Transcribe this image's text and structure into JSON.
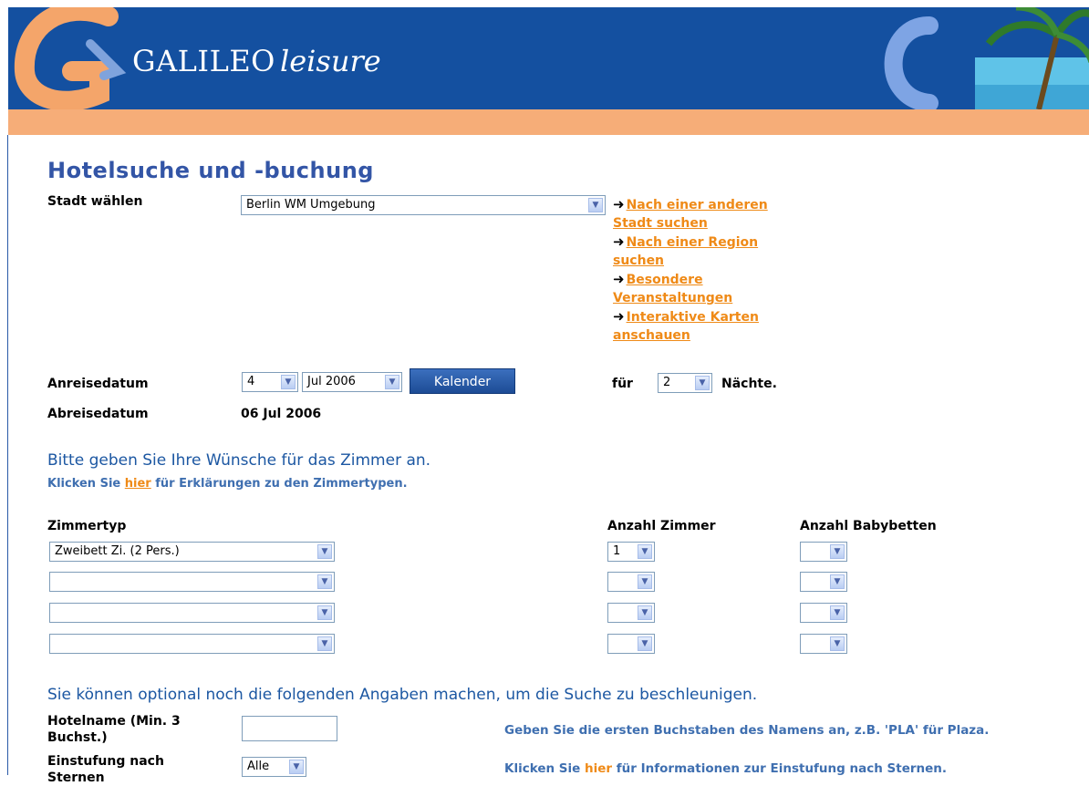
{
  "header": {
    "logo_main": "GALILEO",
    "logo_script": "leisure"
  },
  "page_title": "Hotelsuche und -buchung",
  "city": {
    "label": "Stadt wählen",
    "selected": "Berlin WM Umgebung",
    "links": [
      {
        "line1": "Nach einer anderen",
        "line2": "Stadt suchen"
      },
      {
        "line1": "Nach einer Region",
        "line2": "suchen"
      },
      {
        "line1": "Besondere",
        "line2": "Veranstaltungen"
      },
      {
        "line1": "Interaktive Karten",
        "line2": "anschauen"
      }
    ]
  },
  "arrival": {
    "label": "Anreisedatum",
    "day": "4",
    "month": "Jul 2006",
    "calendar_button": "Kalender",
    "for_label": "für",
    "nights": "2",
    "nights_label": "Nächte."
  },
  "departure": {
    "label": "Abreisedatum",
    "value": "06 Jul 2006"
  },
  "rooms": {
    "heading": "Bitte geben Sie Ihre Wünsche für das Zimmer an.",
    "help_prefix": "Klicken Sie",
    "help_link": "hier",
    "help_suffix": "für Erklärungen zu den Zimmertypen.",
    "col_type": "Zimmertyp",
    "col_count": "Anzahl Zimmer",
    "col_cots": "Anzahl Babybetten",
    "rows": [
      {
        "type": "Zweibett Zi. (2 Pers.)",
        "count": "1",
        "cots": ""
      },
      {
        "type": "",
        "count": "",
        "cots": ""
      },
      {
        "type": "",
        "count": "",
        "cots": ""
      },
      {
        "type": "",
        "count": "",
        "cots": ""
      }
    ]
  },
  "optional": {
    "heading": "Sie können optional noch die folgenden Angaben machen, um die Suche zu beschleunigen.",
    "hotelname_label_1": "Hotelname (Min. 3",
    "hotelname_label_2": "Buchst.)",
    "hotelname_hint": "Geben Sie die ersten Buchstaben des Namens an, z.B. 'PLA' für Plaza.",
    "stars_label_1": "Einstufung nach",
    "stars_label_2": "Sternen",
    "stars_value": "Alle",
    "stars_hint_prefix": "Klicken Sie",
    "stars_hint_link": "hier",
    "stars_hint_suffix": "für Informationen zur Einstufung nach Sternen."
  },
  "colors": {
    "header_blue": "#1450a0",
    "orange_bar": "#f6ad78",
    "title_blue": "#3355a6",
    "link_orange": "#ef8a17"
  }
}
